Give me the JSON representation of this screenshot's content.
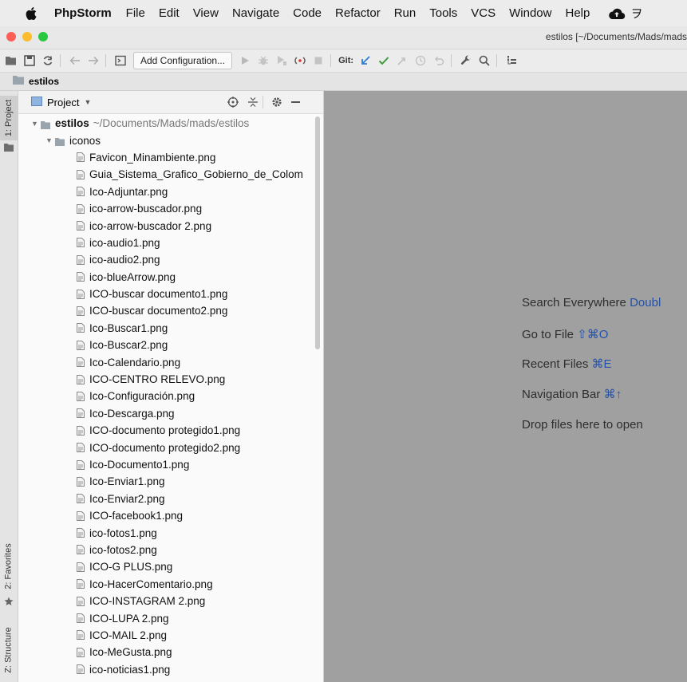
{
  "menubar": {
    "app_name": "PhpStorm",
    "items": [
      "File",
      "Edit",
      "View",
      "Navigate",
      "Code",
      "Refactor",
      "Run",
      "Tools",
      "VCS",
      "Window",
      "Help"
    ],
    "trailing_glyph": "ヲ"
  },
  "window": {
    "title": "estilos [~/Documents/Mads/mads"
  },
  "toolbar": {
    "add_configuration_label": "Add Configuration...",
    "git_label": "Git:"
  },
  "navbar": {
    "breadcrumb": "estilos"
  },
  "left_strip": {
    "project_tab": "1: Project",
    "favorites_tab": "2: Favorites",
    "structure_tab": "Z: Structure"
  },
  "project_panel": {
    "view_label": "Project",
    "root_name": "estilos",
    "root_path": "~/Documents/Mads/mads/estilos",
    "folder_name": "iconos",
    "files": [
      "Favicon_Minambiente.png",
      "Guia_Sistema_Grafico_Gobierno_de_Colom",
      "Ico-Adjuntar.png",
      "ico-arrow-buscador.png",
      "ico-arrow-buscador 2.png",
      "ico-audio1.png",
      "ico-audio2.png",
      "ico-blueArrow.png",
      "ICO-buscar documento1.png",
      "ICO-buscar documento2.png",
      "Ico-Buscar1.png",
      "Ico-Buscar2.png",
      "Ico-Calendario.png",
      "ICO-CENTRO RELEVO.png",
      "Ico-Configuración.png",
      "Ico-Descarga.png",
      "ICO-documento protegido1.png",
      "ICO-documento protegido2.png",
      "Ico-Documento1.png",
      "Ico-Enviar1.png",
      "Ico-Enviar2.png",
      "ICO-facebook1.png",
      "ico-fotos1.png",
      "ico-fotos2.png",
      "ICO-G PLUS.png",
      "Ico-HacerComentario.png",
      "ICO-INSTAGRAM 2.png",
      "ICO-LUPA 2.png",
      "ICO-MAIL 2.png",
      "Ico-MeGusta.png",
      "ico-noticias1.png"
    ]
  },
  "editor": {
    "hints": [
      {
        "text": "Search Everywhere",
        "key": "Doubl"
      },
      {
        "text": "Go to File",
        "key": "⇧⌘O"
      },
      {
        "text": "Recent Files",
        "key": "⌘E"
      },
      {
        "text": "Navigation Bar",
        "key": "⌘↑"
      },
      {
        "text": "Drop files here to open",
        "key": ""
      }
    ]
  },
  "colors": {
    "editor_background": "#a0a0a0",
    "shortcut_key": "#2451a8",
    "traffic_close": "#fc5f57",
    "traffic_minimize": "#fdbc2e",
    "traffic_zoom": "#28c840"
  }
}
